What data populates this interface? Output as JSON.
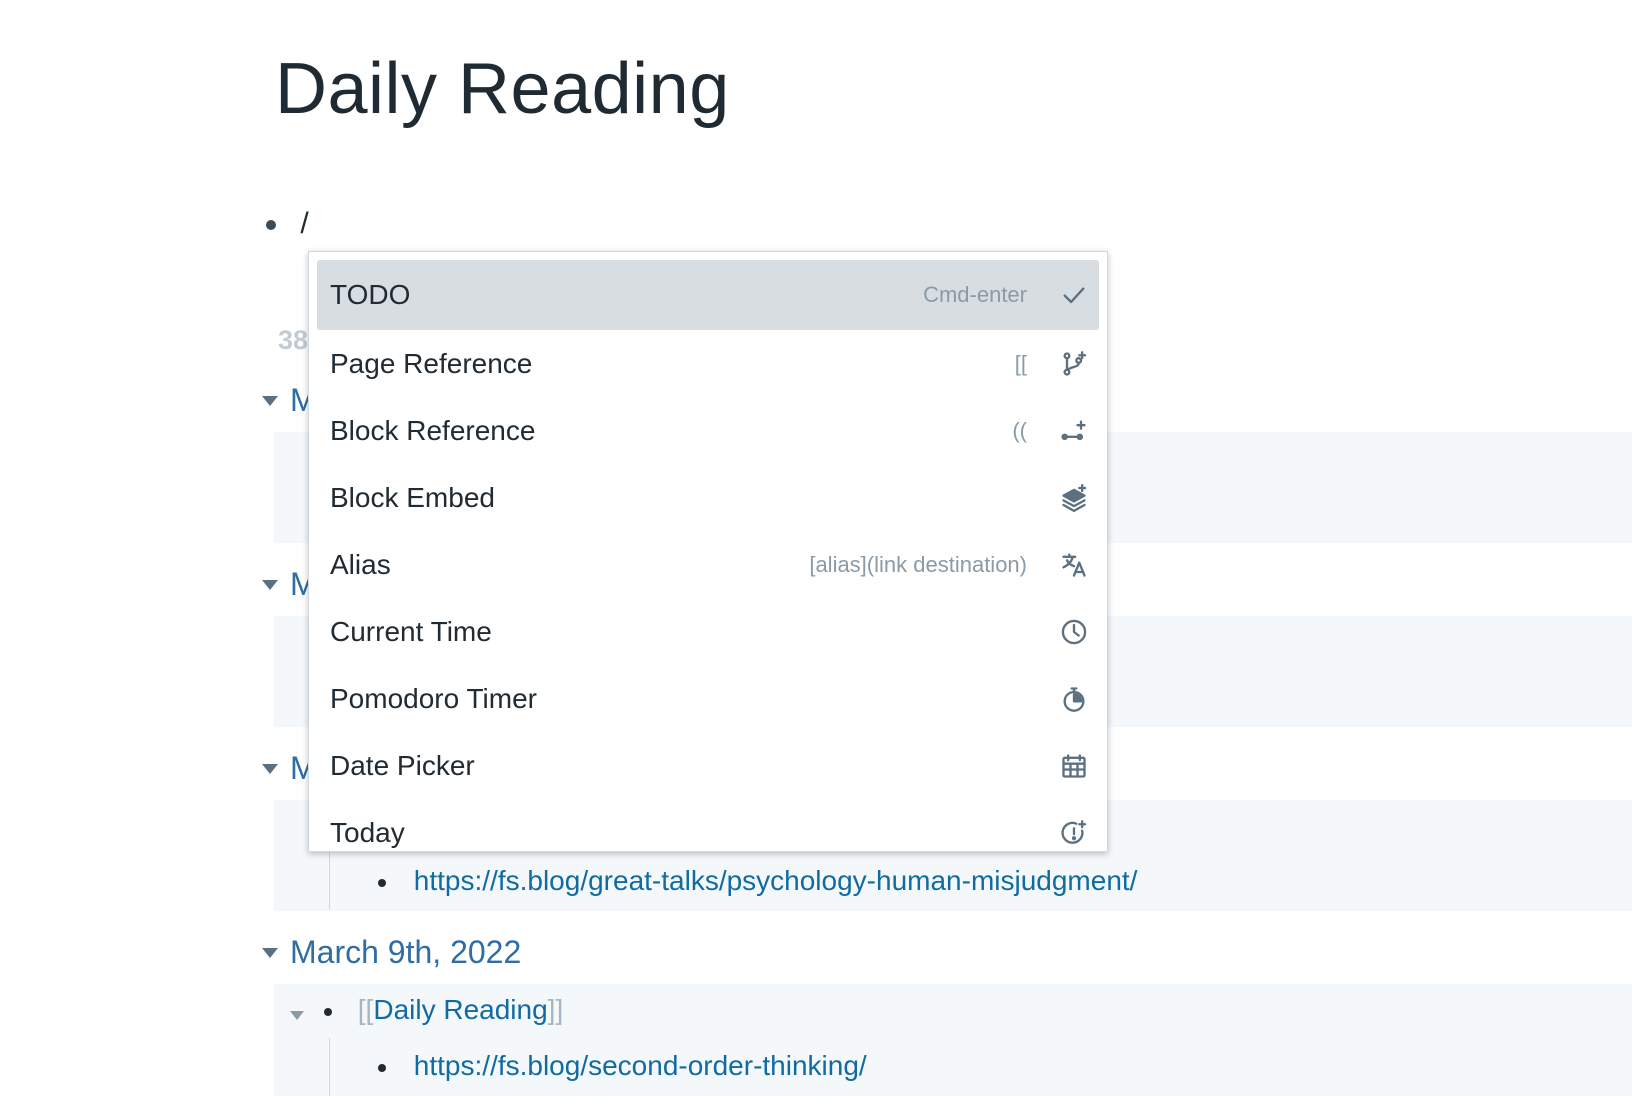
{
  "page": {
    "title": "Daily Reading",
    "input_text": "/",
    "ref_count": "38"
  },
  "menu": {
    "items": [
      {
        "label": "TODO",
        "hint": "Cmd-enter",
        "icon": "check-icon"
      },
      {
        "label": "Page Reference",
        "hint": "[[",
        "icon": "branch-icon"
      },
      {
        "label": "Block Reference",
        "hint": "((",
        "icon": "block-ref-icon"
      },
      {
        "label": "Block Embed",
        "hint": "",
        "icon": "layers-icon"
      },
      {
        "label": "Alias",
        "hint": "[alias](link destination)",
        "icon": "translate-icon"
      },
      {
        "label": "Current Time",
        "hint": "",
        "icon": "clock-icon"
      },
      {
        "label": "Pomodoro Timer",
        "hint": "",
        "icon": "stopwatch-icon"
      },
      {
        "label": "Date Picker",
        "hint": "",
        "icon": "calendar-icon"
      },
      {
        "label": "Today",
        "hint": "",
        "icon": "time-alert-icon"
      }
    ]
  },
  "refs": {
    "partial_first_letter": "M",
    "link_1": "https://fs.blog/great-talks/psychology-human-misjudgment/",
    "date_4": "March 9th, 2022",
    "ref_open": "[[",
    "ref_label": "Daily Reading",
    "ref_close": "]]",
    "link_2": "https://fs.blog/second-order-thinking/"
  }
}
